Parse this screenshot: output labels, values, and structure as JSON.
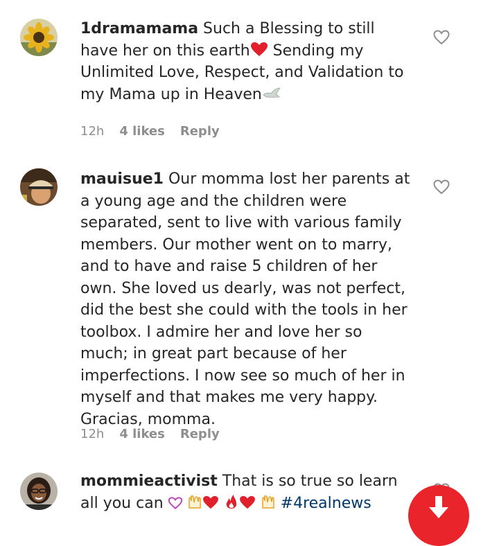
{
  "comments": [
    {
      "username": "1dramamama",
      "text_a": " Such a Blessing to still have her on this earth",
      "text_b": " Sending my Unlimited Love, Respect, and Validation to my Mama up in Heaven",
      "time": "12h",
      "likes": "4 likes",
      "reply": "Reply",
      "avatar_icon": "sunflower-avatar",
      "emojis": [
        "red-heart",
        "dove"
      ]
    },
    {
      "username": "mauisue1",
      "text": " Our momma lost her parents at a young age and the children were separated, sent to live with various family members. Our mother went on to marry, and to have and raise 5 children of her own. She loved us dearly, was not perfect, did the best she could with the tools in her toolbox. I admire her and love her so much; in great part because of her imperfections. I now see so much of her in myself and that makes me very happy. Gracias, momma.",
      "time": "12h",
      "likes": "4 likes",
      "reply": "Reply",
      "avatar_icon": "person-in-cap-avatar"
    },
    {
      "username": "mommieactivist",
      "text_a": " That is so true so learn all you can ",
      "hashtag": "#4realnews",
      "avatar_icon": "woman-portrait-avatar",
      "emojis": [
        "sparkling-heart",
        "raising-hands",
        "red-heart",
        "fire",
        "red-heart",
        "raising-hands"
      ]
    }
  ],
  "colors": {
    "text": "#262626",
    "meta": "#8e8e8e",
    "hashtag": "#00376b",
    "heart_emoji": "#e0202a",
    "fab": "#e9242b"
  },
  "fab": {
    "icon": "arrow-down-icon"
  }
}
